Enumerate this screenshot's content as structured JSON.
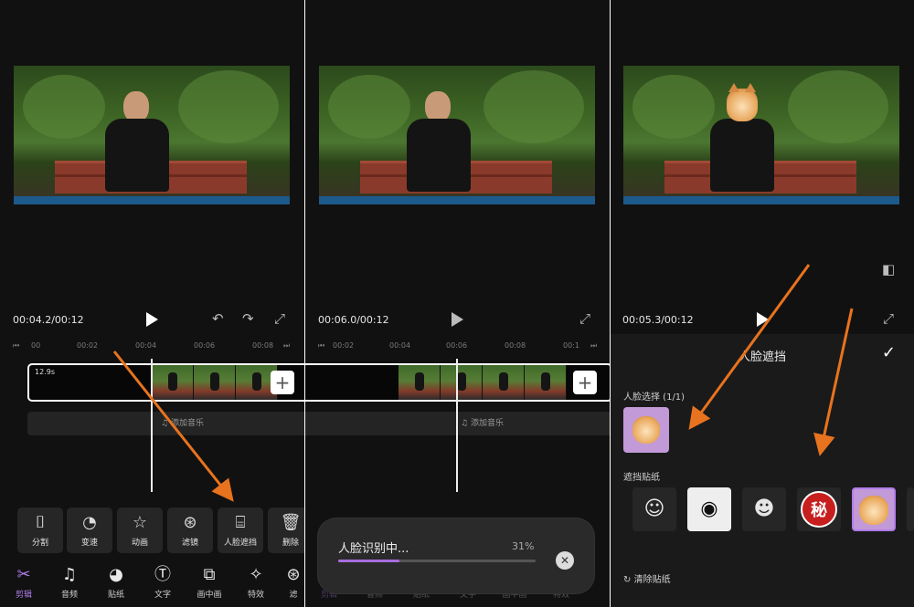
{
  "panel1": {
    "timecode": "00:04.2/00:12",
    "ruler": [
      "00",
      "00:02",
      "00:04",
      "00:06",
      "00:08"
    ],
    "clip_duration": "12.9s",
    "music_label": "添加音乐",
    "tools": [
      {
        "label": "分割",
        "icon": "split-icon"
      },
      {
        "label": "变速",
        "icon": "speed-icon"
      },
      {
        "label": "动画",
        "icon": "animation-icon"
      },
      {
        "label": "滤镜",
        "icon": "filter-icon"
      },
      {
        "label": "人脸遮挡",
        "icon": "face-mask-icon"
      },
      {
        "label": "删除",
        "icon": "delete-icon"
      }
    ],
    "nav": [
      {
        "label": "剪辑",
        "icon": "scissors-icon"
      },
      {
        "label": "音频",
        "icon": "music-note-icon"
      },
      {
        "label": "贴纸",
        "icon": "sticker-icon"
      },
      {
        "label": "文字",
        "icon": "text-icon"
      },
      {
        "label": "画中画",
        "icon": "pip-icon"
      },
      {
        "label": "特效",
        "icon": "effects-icon"
      },
      {
        "label": "滤",
        "icon": "filter-icon"
      }
    ]
  },
  "panel2": {
    "timecode": "00:06.0/00:12",
    "ruler": [
      "00:02",
      "00:04",
      "00:06",
      "00:08",
      "00:1"
    ],
    "music_label": "添加音乐",
    "progress": {
      "title": "人脸识别中...",
      "percent_label": "31%",
      "percent": 31
    },
    "nav": [
      "剪辑",
      "音频",
      "贴纸",
      "文字",
      "画中画",
      "特效"
    ]
  },
  "panel3": {
    "timecode": "00:05.3/00:12",
    "sheet_title": "人脸遮挡",
    "face_select_label": "人脸选择 (1/1)",
    "sticker_label": "遮挡贴纸",
    "stickers": [
      {
        "icon": "statue-sticker-icon"
      },
      {
        "icon": "panda-sticker-icon"
      },
      {
        "icon": "statue2-sticker-icon"
      },
      {
        "icon": "secret-sticker-icon",
        "text": "秘"
      },
      {
        "icon": "cat-sticker-icon"
      }
    ],
    "clear_label": "清除贴纸"
  },
  "colors": {
    "accent": "#b07ce8",
    "arrow": "#e8731e",
    "background": "#111111"
  }
}
